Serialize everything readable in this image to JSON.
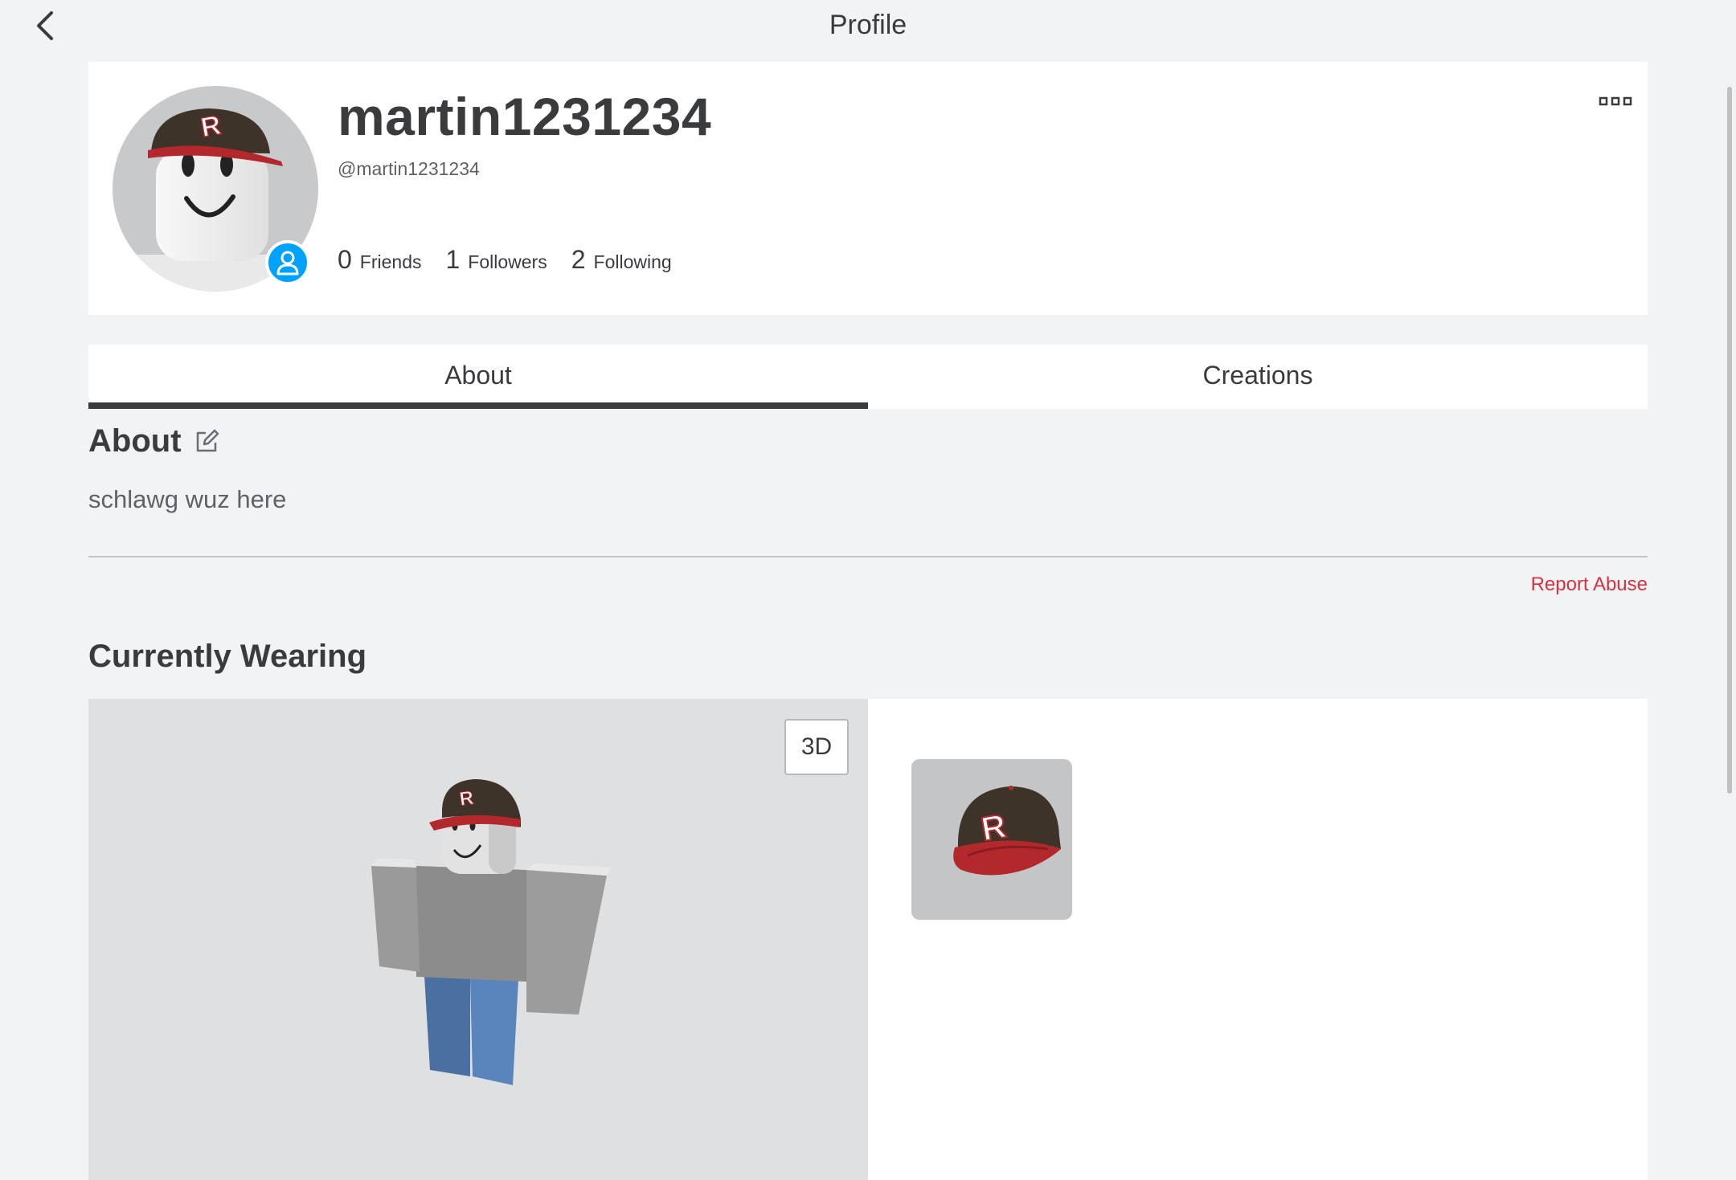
{
  "topbar": {
    "title": "Profile"
  },
  "profile": {
    "display_name": "martin1231234",
    "username": "@martin1231234",
    "stats": [
      {
        "count": "0",
        "label": "Friends"
      },
      {
        "count": "1",
        "label": "Followers"
      },
      {
        "count": "2",
        "label": "Following"
      }
    ]
  },
  "tabs": [
    {
      "label": "About",
      "active": true
    },
    {
      "label": "Creations",
      "active": false
    }
  ],
  "about": {
    "heading": "About",
    "description": "schlawg wuz here",
    "report_label": "Report Abuse"
  },
  "wearing": {
    "heading": "Currently Wearing",
    "view_toggle_label": "3D",
    "items": [
      {
        "icon": "red-r-baseball-cap"
      }
    ]
  },
  "colors": {
    "background": "#f2f3f4",
    "card": "#ffffff",
    "text": "#393b3d",
    "presence_blue": "#00a2ff",
    "report_red": "#d9313f",
    "hat_brown": "#3d3329",
    "hat_red": "#b3282d"
  }
}
